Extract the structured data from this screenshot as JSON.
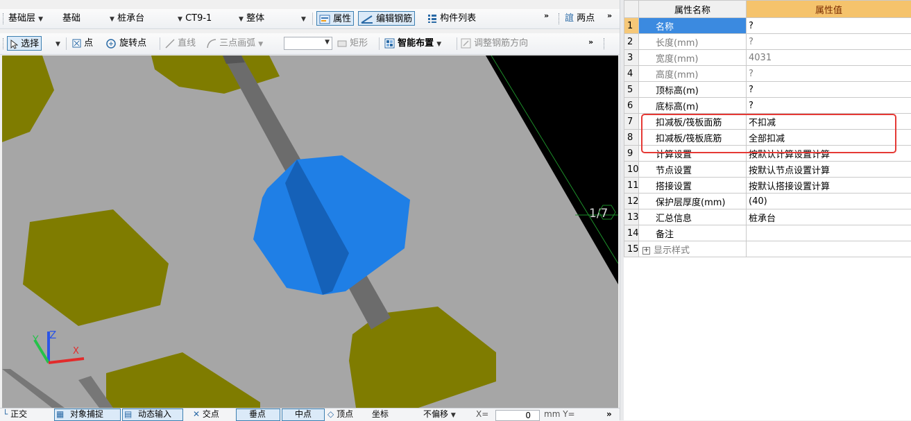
{
  "toolbar1": {
    "floor": "基础层",
    "category": "基础",
    "type": "桩承台",
    "element": "CT9-1",
    "scope": "整体",
    "properties_btn": "属性",
    "edit_rebar_btn": "编辑钢筋",
    "component_list_btn": "构件列表",
    "two_point_btn": "两点"
  },
  "toolbar2": {
    "select_btn": "选择",
    "point_btn": "点",
    "rotate_point_btn": "旋转点",
    "line_btn": "直线",
    "arc_btn": "三点画弧",
    "rect_btn": "矩形",
    "smart_layout_btn": "智能布置",
    "adjust_rebar_btn": "调整钢筋方向"
  },
  "viewport": {
    "axis_label": "1/7",
    "axis_x": "X",
    "axis_y": "Y",
    "axis_z": "Z",
    "colors": {
      "background": "#a6a6a6",
      "pile_cap": "#7f7c00",
      "selected": "#1f7fe6",
      "beam": "#6f6f6f"
    }
  },
  "bottombar": {
    "ortho": "正交",
    "object_snap": "对象捕捉",
    "dynamic_input": "动态输入",
    "intersection": "交点",
    "perpendicular": "垂点",
    "midpoint": "中点",
    "vertex": "顶点",
    "coordinate": "坐标",
    "offset": "不偏移",
    "x_label": "X=",
    "x_value": "0",
    "unit_y": "mm Y="
  },
  "properties": {
    "header_name": "属性名称",
    "header_value": "属性值",
    "rows": [
      {
        "num": "1",
        "name": "名称",
        "value": "?"
      },
      {
        "num": "2",
        "name": "长度(mm)",
        "value": "?"
      },
      {
        "num": "3",
        "name": "宽度(mm)",
        "value": "4031"
      },
      {
        "num": "4",
        "name": "高度(mm)",
        "value": "?"
      },
      {
        "num": "5",
        "name": "顶标高(m)",
        "value": "?"
      },
      {
        "num": "6",
        "name": "底标高(m)",
        "value": "?"
      },
      {
        "num": "7",
        "name": "扣减板/筏板面筋",
        "value": "不扣减"
      },
      {
        "num": "8",
        "name": "扣减板/筏板底筋",
        "value": "全部扣减"
      },
      {
        "num": "9",
        "name": "计算设置",
        "value": "按默认计算设置计算"
      },
      {
        "num": "10",
        "name": "节点设置",
        "value": "按默认节点设置计算"
      },
      {
        "num": "11",
        "name": "搭接设置",
        "value": "按默认搭接设置计算"
      },
      {
        "num": "12",
        "name": "保护层厚度(mm)",
        "value": "(40)"
      },
      {
        "num": "13",
        "name": "汇总信息",
        "value": "桩承台"
      },
      {
        "num": "14",
        "name": "备注",
        "value": ""
      },
      {
        "num": "15",
        "name": "显示样式",
        "value": ""
      }
    ]
  }
}
